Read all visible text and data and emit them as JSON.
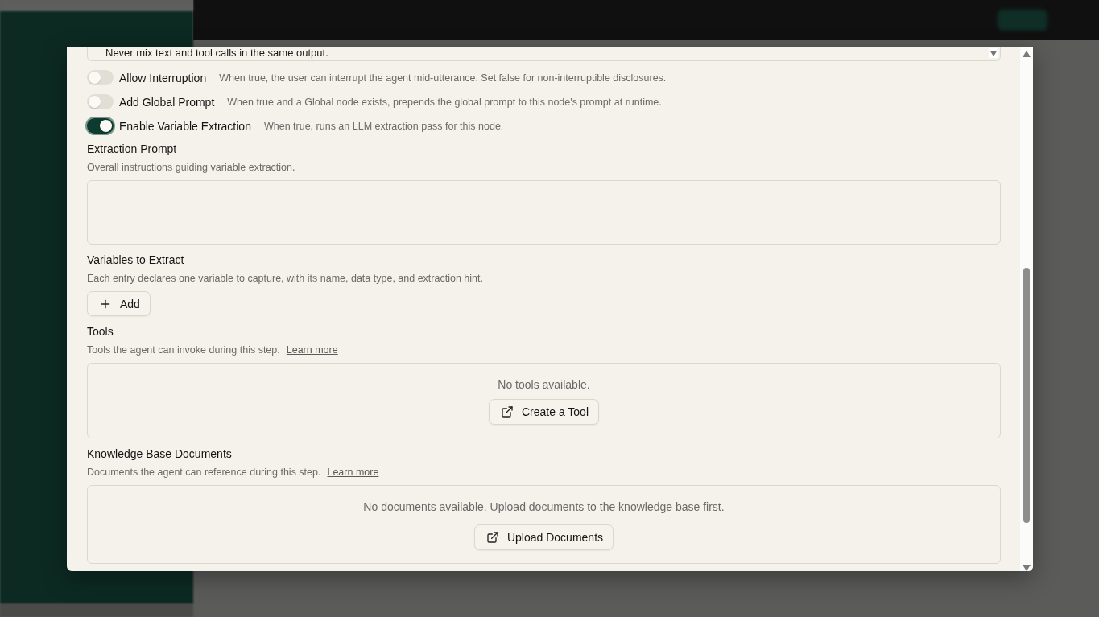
{
  "prompt_field": {
    "value": "Never mix text and tool calls in the same output."
  },
  "toggles": [
    {
      "label": "Allow Interruption",
      "description": "When true, the user can interrupt the agent mid-utterance. Set false for non-interruptible disclosures.",
      "on": false,
      "focused": false
    },
    {
      "label": "Add Global Prompt",
      "description": "When true and a Global node exists, prepends the global prompt to this node's prompt at runtime.",
      "on": false,
      "focused": false
    },
    {
      "label": "Enable Variable Extraction",
      "description": "When true, runs an LLM extraction pass for this node.",
      "on": true,
      "focused": true
    }
  ],
  "extraction_prompt": {
    "label": "Extraction Prompt",
    "description": "Overall instructions guiding variable extraction."
  },
  "variables": {
    "label": "Variables to Extract",
    "description": "Each entry declares one variable to capture, with its name, data type, and extraction hint.",
    "add_button": "Add"
  },
  "tools": {
    "label": "Tools",
    "description": "Tools the agent can invoke during this step.",
    "link": "Learn more",
    "empty_text": "No tools available.",
    "button": "Create a Tool"
  },
  "knowledge_base": {
    "label": "Knowledge Base Documents",
    "description": "Documents the agent can reference during this step.",
    "link": "Learn more",
    "empty_text": "No documents available. Upload documents to the knowledge base first.",
    "button": "Upload Documents"
  }
}
